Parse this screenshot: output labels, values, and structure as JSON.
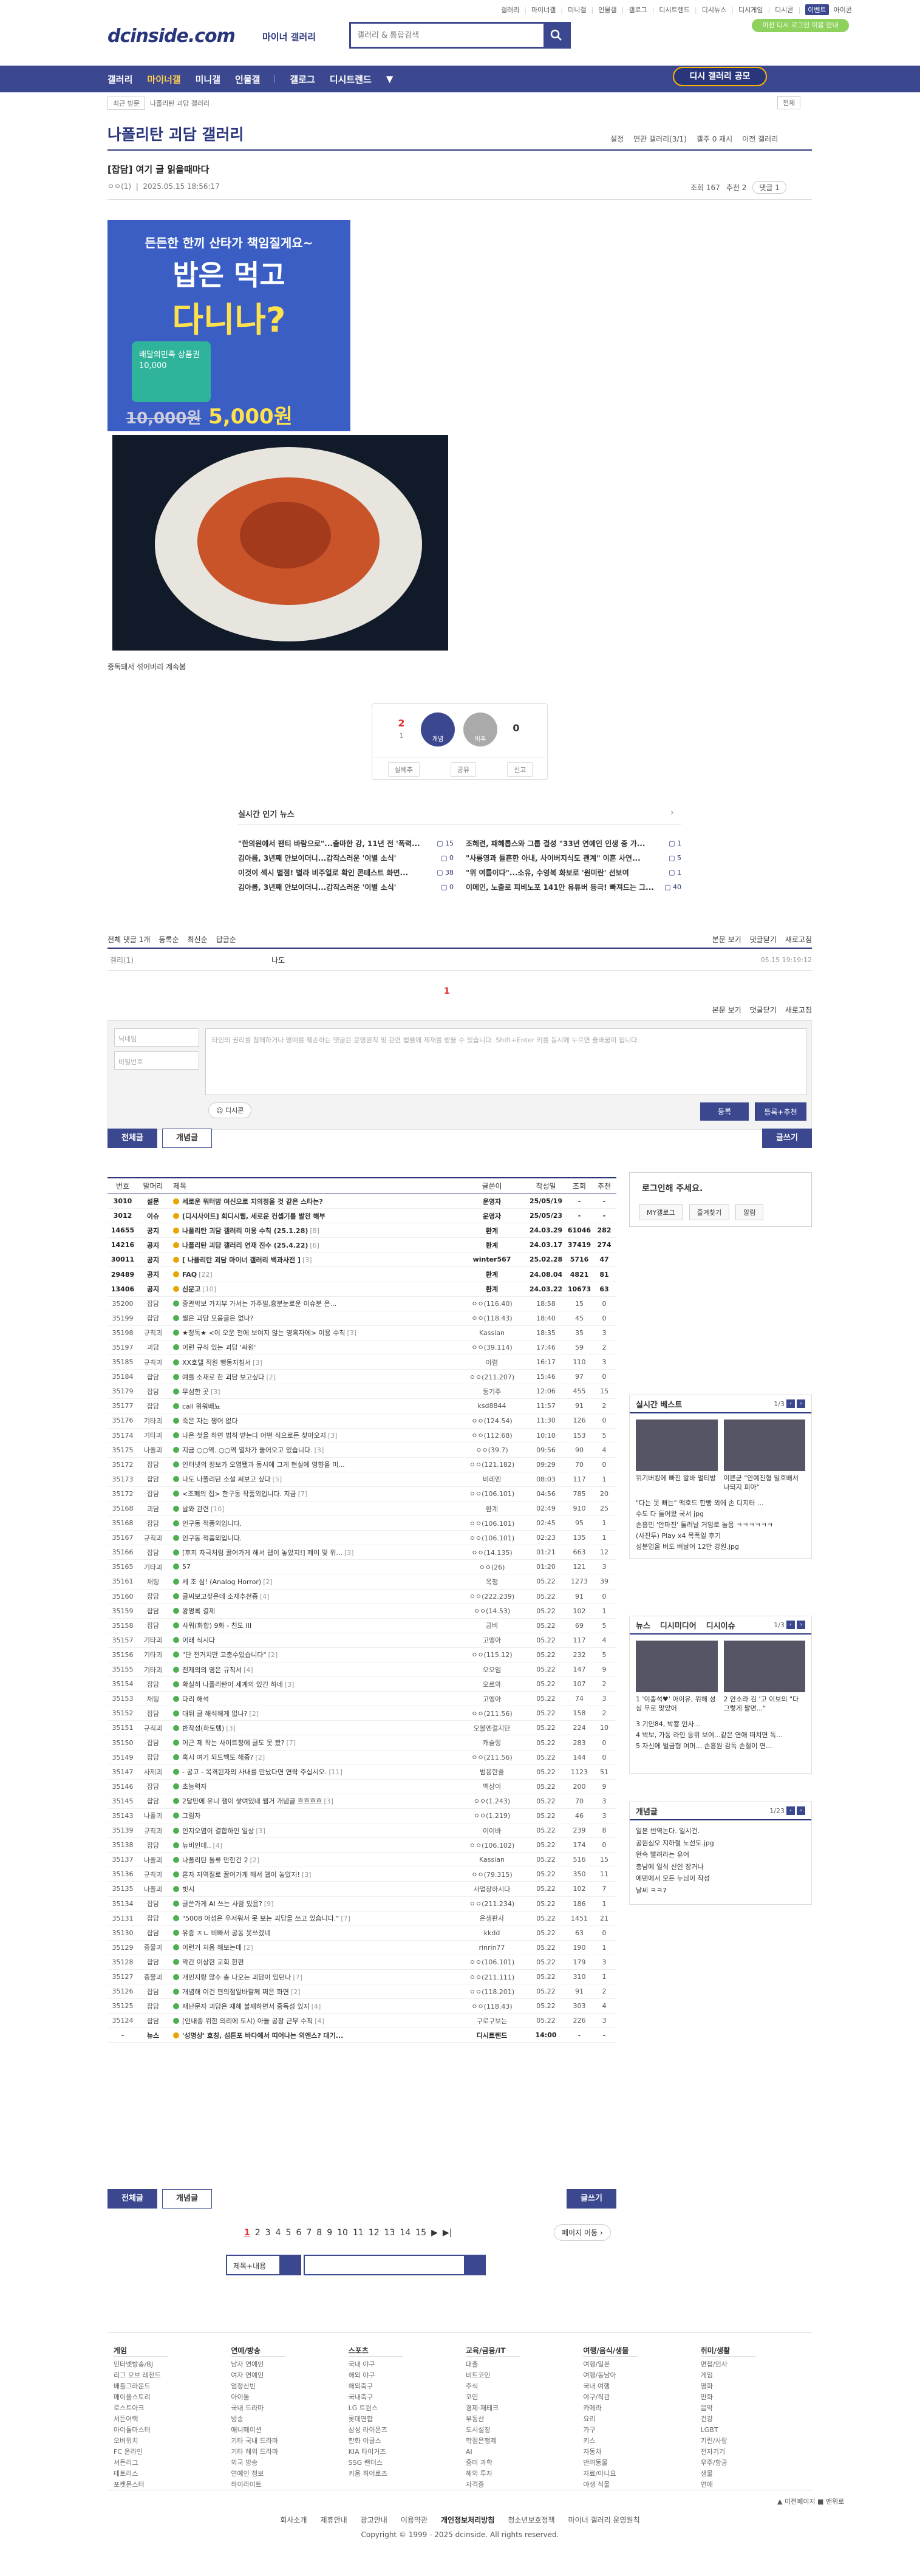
{
  "util": {
    "links": [
      "갤러리",
      "마이너갤",
      "미니갤",
      "인물갤",
      "갤로그",
      "디시트렌드",
      "디시뉴스",
      "디시게임",
      "디시콘"
    ],
    "active": "이벤트",
    "tail": "아이콘"
  },
  "header": {
    "logo": "dcinside.com",
    "sub": "마이너 갤러리",
    "search_placeholder": "갤러리 & 통합검색",
    "login_button": "이전 디시 로그인 이용 안내"
  },
  "gnb": {
    "items": [
      "갤러리",
      "마이너갤",
      "미니갤",
      "인물갤",
      "갤로그",
      "디시트렌드"
    ],
    "active_index": 1,
    "button": "디시 갤러리 공모"
  },
  "breadcrumb": {
    "recent": "최근 방문",
    "current": "나폴리탄 괴담 갤러리",
    "right": "전체"
  },
  "gallery": {
    "title": "나폴리탄 괴담 갤러리",
    "menu": [
      "설정",
      "연관 갤러리(3/1)",
      "갤주 0 재시",
      "이전 갤러리"
    ]
  },
  "post": {
    "title": "[잡담] 여기 글 읽을때마다",
    "author": "ㅇㅇ(1)",
    "date": "2025.05.15 18:56:17",
    "views": "조회 167",
    "recommend": "추천 2",
    "comments": "댓글 1",
    "caption": "중독돼서 섞어버리 계속봄"
  },
  "ad": {
    "line1": "든든한 한끼 산타가 책임질게요~",
    "line2": "밥은 먹고",
    "line3": "다니나?",
    "card": "배달의민족 상품권 10,000",
    "old_price": "10,000원",
    "new_price": "5,000원"
  },
  "vote": {
    "up": "2",
    "up_sub": "1",
    "up_label": "개념",
    "down_label": "비추",
    "down": "0",
    "buttons": [
      "실베추",
      "공유",
      "신고"
    ]
  },
  "news": {
    "title": "실시간 인기 뉴스",
    "left": [
      {
        "t": "\"한의원에서 팬티 바람으로\"...출마한 강, 11년 전 '폭력...",
        "c": "15"
      },
      {
        "t": "김아름, 3년째 안보이더니...갑작스러운 '이별 소식'",
        "c": "0"
      },
      {
        "t": "이것이 섹시 별점! 별라 비주얼로 확인 콘테스트 화면...",
        "c": "38"
      },
      {
        "t": "김아름, 3년째 안보이더니...갑작스러운 '이별 소식'",
        "c": "0"
      }
    ],
    "right": [
      {
        "t": "조혜련, 패혜롭스와 그룹 결성 \"33년 연예인 인생 중 가...",
        "c": "1"
      },
      {
        "t": "\"사릉영과 들흔한 아내, 사이버지식도 괜계\" 이혼 사연...",
        "c": "5"
      },
      {
        "t": "\"위 여름이다\"...소유, 수영복 화보로 '원미란' 선보여",
        "c": "1"
      },
      {
        "t": "이메인, 노출로 피비노포 141만 유튜버 등극! 빠져드는 그...",
        "c": "40"
      }
    ]
  },
  "comments": {
    "bar_left": [
      "전체 댓글 1개",
      "등록순",
      "최신순",
      "답글순"
    ],
    "bar_right": [
      "본문 보기",
      "댓글닫기",
      "새로고침"
    ],
    "nick": "갤리(1)",
    "text": "나도",
    "date": "05.15 19:19:12",
    "page": "1",
    "name_ph": "닉네임",
    "pw_ph": "비밀번호",
    "textarea_ph": "타인의 권리를 침해하거나 명예를 훼손하는 댓글은 운영원칙 및 관련 법률에 제재를 받을 수 있습니다. Shift+Enter 키를 동시에 누르면 줄바꿈이 됩니다.",
    "dccon": "디시콘",
    "submit": "등록",
    "submit2": "등록+추천"
  },
  "list": {
    "tab_all": "전체글",
    "tab_best": "개념글",
    "write": "글쓰기",
    "headers": [
      "번호",
      "말머리",
      "제목",
      "글쓴이",
      "작성일",
      "조회",
      "추천"
    ],
    "rows": [
      [
        "3010",
        "설문",
        "세로운 워터밤 여신으로 지의정을 것 같은 스타는?",
        "운영자",
        "25/05/19",
        "-",
        "-",
        1,
        ""
      ],
      [
        "3012",
        "이슈",
        "[디시사이트] 회디시웹, 세로운 컨셉기를 발전 해부",
        "운영자",
        "25/05/23",
        "-",
        "-",
        1,
        ""
      ],
      [
        "14655",
        "공지",
        "나폴리탄 괴담 갤러리 이용 수칙 (25.1.28)",
        "환계",
        "24.03.29",
        "61046",
        "282",
        1,
        "[8]"
      ],
      [
        "14216",
        "공지",
        "나폴리탄 괴담 갤러리 연재 진수 (25.4.22)",
        "환계",
        "24.03.17",
        "37419",
        "274",
        1,
        "[6]"
      ],
      [
        "30011",
        "공지",
        "[ 나폴리탄 괴담 마이너 갤러리 백과사전 ]",
        "winter567",
        "25.02.28",
        "5716",
        "47",
        1,
        "[3]"
      ],
      [
        "29489",
        "공지",
        "FAQ",
        "환계",
        "24.08.04",
        "4821",
        "81",
        1,
        "[22]"
      ],
      [
        "13406",
        "공지",
        "신문고",
        "환계",
        "24.03.22",
        "10673",
        "63",
        1,
        "[10]"
      ],
      [
        "35200",
        "잡담",
        "중관박보 가치부 가서는 가주빌,흉분눈로운 이슈분 은...",
        "ㅇㅇ(116.40)",
        "18:58",
        "15",
        "0",
        0,
        ""
      ],
      [
        "35199",
        "잡담",
        "별은 괴담 모음글은 없나?",
        "ㅇㅇ(118.43)",
        "18:40",
        "45",
        "0",
        0,
        ""
      ],
      [
        "35198",
        "규칙괴",
        "★정독★ <이 오운 천에 보여지 않는 영혹자에>  이용 수칙",
        "Kassian",
        "18:35",
        "35",
        "3",
        0,
        "[3]"
      ],
      [
        "35197",
        "괴담",
        "이런 규칙 있는 괴담 '싸원'",
        "ㅇㅇ(39.114)",
        "17:46",
        "59",
        "2",
        0,
        ""
      ],
      [
        "35185",
        "규칙괴",
        "XX호텔 직원 행동지침서",
        "아렴",
        "16:17",
        "110",
        "3",
        0,
        "[3]"
      ],
      [
        "35184",
        "잡담",
        "예를 소재로 한 괴담 보고싶다",
        "ㅇㅇ(211.207)",
        "15:46",
        "97",
        "0",
        0,
        "[2]"
      ],
      [
        "35179",
        "잡담",
        "무섬한 곳",
        "동기주",
        "12:06",
        "455",
        "15",
        0,
        "[3]"
      ],
      [
        "35177",
        "잡담",
        "call 위워배뇨",
        "ksd8844",
        "11:57",
        "91",
        "2",
        0,
        ""
      ],
      [
        "35176",
        "기타괴",
        "죽은 자는 쩡어 없다",
        "ㅇㅇ(124.54)",
        "11:30",
        "126",
        "0",
        0,
        ""
      ],
      [
        "35174",
        "기타괴",
        "나은 첫을 하면 법칙 받는다 어떤 식으로든 찾아오지",
        "ㅇㅇ(112.68)",
        "10:10",
        "153",
        "5",
        0,
        "[3]"
      ],
      [
        "35175",
        "나폴괴",
        "지금 ○○역. ○○역 열차가 들어오고 있습니다.",
        "ㅇㅇ(39.7)",
        "09:56",
        "90",
        "4",
        0,
        "[3]"
      ],
      [
        "35172",
        "잡담",
        "인터넷의 정보가 오염됐과 동시에 그게 현실에 영향을 미...",
        "ㅇㅇ(121.182)",
        "09:29",
        "70",
        "0",
        0,
        ""
      ],
      [
        "35173",
        "잡담",
        "나도 나폴리탄 소설 써보고 싶다",
        "비레엔",
        "08:03",
        "117",
        "1",
        0,
        "[5]"
      ],
      [
        "35172",
        "잡담",
        "<조폐의 집> 한구동 작품외입니다. 지금",
        "ㅇㅇ(106.101)",
        "04:56",
        "785",
        "20",
        0,
        "[7]"
      ],
      [
        "35168",
        "괴담",
        "날와 관련",
        "환계",
        "02:49",
        "910",
        "25",
        0,
        "[10]"
      ],
      [
        "35168",
        "잡담",
        "인구동 적품외입니다.",
        "ㅇㅇ(106.101)",
        "02:45",
        "95",
        "1",
        0,
        ""
      ],
      [
        "35167",
        "규칙괴",
        "인구동 적품외입니다.",
        "ㅇㅇ(106.101)",
        "02:23",
        "135",
        "1",
        0,
        ""
      ],
      [
        "35166",
        "잡담",
        "[후지 자극처럼 꿀어가게 해서 웹이 놓았지!] 제이 및 위...",
        "ㅇㅇ(14.135)",
        "01:21",
        "663",
        "12",
        0,
        "[3]"
      ],
      [
        "35165",
        "기타괴",
        "57",
        "ㅇㅇ(26)",
        "01:20",
        "121",
        "3",
        0,
        ""
      ],
      [
        "35161",
        "채팅",
        "세 조 심! (Analog Horror)",
        "옥청",
        "05.22",
        "1273",
        "39",
        0,
        "[2]"
      ],
      [
        "35160",
        "잡담",
        "글씨보고싶은데 소재추천좀",
        "ㅇㅇ(222.239)",
        "05.22",
        "91",
        "0",
        0,
        "[4]"
      ],
      [
        "35159",
        "잡담",
        "왕명록 결제",
        "ㅇㅇ(14.53)",
        "05.22",
        "102",
        "1",
        0,
        ""
      ],
      [
        "35158",
        "잡담",
        "사워(화합) 9화 - 친도 III",
        "금비",
        "05.22",
        "69",
        "5",
        0,
        ""
      ],
      [
        "35157",
        "기타괴",
        "이래 식시다",
        "고앵아",
        "05.22",
        "117",
        "4",
        0,
        ""
      ],
      [
        "35156",
        "기타괴",
        "\"단 전거치만 고충수있습니다\"",
        "ㅇㅇ(115.12)",
        "05.22",
        "232",
        "5",
        0,
        "[2]"
      ],
      [
        "35155",
        "기타괴",
        "전제의의 영은 규칙서",
        "오오임",
        "05.22",
        "147",
        "9",
        0,
        "[4]"
      ],
      [
        "35154",
        "잡담",
        "확실히 나폴리탄이 세계의 있긴 하네",
        "오르와",
        "05.22",
        "107",
        "2",
        0,
        "[3]"
      ],
      [
        "35153",
        "채팅",
        "다리 해석",
        "고앵아",
        "05.22",
        "74",
        "3",
        0,
        ""
      ],
      [
        "35152",
        "잡담",
        "대뒤 글 해석해게 없나?",
        "ㅇㅇ(211.56)",
        "05.22",
        "158",
        "2",
        0,
        "[2]"
      ],
      [
        "35151",
        "규칙괴",
        "반작성(하토템)",
        "오볼엔걸지단",
        "05.22",
        "224",
        "10",
        0,
        "[3]"
      ],
      [
        "35150",
        "잡담",
        "이근 제 작는 사이트정에 글도 못 봤?",
        "캐슬링",
        "05.22",
        "283",
        "0",
        0,
        "[7]"
      ],
      [
        "35149",
        "잡담",
        "혹시 여기 되드백도 해줌?",
        "ㅇㅇ(211.56)",
        "05.22",
        "144",
        "0",
        0,
        "[2]"
      ],
      [
        "35147",
        "사제괴",
        "- 공고 - 목격된자의 사내를 만났다면 연락 주십시오.",
        "범용한풀",
        "05.22",
        "1123",
        "51",
        0,
        "[11]"
      ],
      [
        "35146",
        "잡담",
        "초능력자",
        "맥상이",
        "05.22",
        "200",
        "9",
        0,
        ""
      ],
      [
        "35145",
        "잡담",
        "2달만에 유니 잼이 쌓여있네 웹거 개념글 흐흐흐흐",
        "ㅇㅇ(1.243)",
        "05.22",
        "70",
        "3",
        0,
        "[3]"
      ],
      [
        "35143",
        "나폴괴",
        "그림자",
        "ㅇㅇ(1.219)",
        "05.22",
        "46",
        "3",
        0,
        ""
      ],
      [
        "35139",
        "규칙괴",
        "인지오염이 결합하인 일상",
        "이이바",
        "05.22",
        "239",
        "8",
        0,
        "[3]"
      ],
      [
        "35138",
        "잡담",
        "뉴비인데..",
        "ㅇㅇ(106.102)",
        "05.22",
        "174",
        "0",
        0,
        "[4]"
      ],
      [
        "35137",
        "나폴괴",
        "나폴리탄 돌류 만한건 2",
        "Kassian",
        "05.22",
        "516",
        "15",
        0,
        "[2]"
      ],
      [
        "35136",
        "규칙괴",
        "혼자 자역질로 꿀어가게 해서 웹이 놓았지!",
        "ㅇㅇ(79.315)",
        "05.22",
        "350",
        "11",
        0,
        "[3]"
      ],
      [
        "35135",
        "나폴괴",
        "빗시",
        "사업장하시다",
        "05.22",
        "102",
        "7",
        0,
        ""
      ],
      [
        "35134",
        "잡담",
        "글쓴가게 AI 쓰는 사람 있음?",
        "ㅇㅇ(211.234)",
        "05.22",
        "186",
        "1",
        0,
        "[9]"
      ],
      [
        "35131",
        "잡담",
        "\"5008 아성은 우서워서 못 보는 괴담을 쓰고 있습니다.\"",
        "은생판사",
        "05.22",
        "1451",
        "21",
        0,
        "[7]"
      ],
      [
        "35130",
        "잡담",
        "유증 ㅈㄴ 비빠서 공동 못쓰겠네",
        "kkdd",
        "05.22",
        "63",
        "0",
        0,
        ""
      ],
      [
        "35129",
        "중물괴",
        "이런거 처음 해보는데",
        "rinrin77",
        "05.22",
        "190",
        "1",
        0,
        "[2]"
      ],
      [
        "35128",
        "잡담",
        "막간 이상한 교회 한편",
        "ㅇㅇ(106.101)",
        "05.22",
        "179",
        "3",
        0,
        ""
      ],
      [
        "35127",
        "중물괴",
        "개인지량 많수 총 나오는 괴담이 있던나",
        "ㅇㅇ(211.111)",
        "05.22",
        "310",
        "1",
        0,
        "[7]"
      ],
      [
        "35126",
        "잡담",
        "개념해 이건 편의점알바할께 쩌은 화면",
        "ㅇㅇ(118.201)",
        "05.22",
        "91",
        "2",
        0,
        "[2]"
      ],
      [
        "35125",
        "잡담",
        "재난문자 괴담은 재해 불재하면서 중독성 있지",
        "ㅇㅇ(118.43)",
        "05.22",
        "303",
        "4",
        0,
        "[4]"
      ],
      [
        "35124",
        "잡담",
        "[인내중 위한 의리에 도시) 아들 공장 근무 수칙",
        "구로구보는",
        "05.22",
        "226",
        "3",
        0,
        "[4]"
      ],
      [
        "-",
        "뉴스",
        "'성명상' 효칭, 섬튼포 바다에서 띠어나는 외엔스? 대기...",
        "디시트렌드",
        "14:00",
        "-",
        "-",
        1,
        ""
      ]
    ],
    "pager": [
      "1",
      "2",
      "3",
      "4",
      "5",
      "6",
      "7",
      "8",
      "9",
      "10",
      "11",
      "12",
      "13",
      "14",
      "15",
      "▶",
      "▶|"
    ],
    "page_move": "페이지 이동",
    "search_select": "제목+내용"
  },
  "side": {
    "login_title": "로그인해 주세요.",
    "login_btns": [
      "MY갤로그",
      "즐겨찾기",
      "알림"
    ],
    "best_title": "실시간 베스트",
    "best_page": "1/3",
    "best_thumbs": [
      "위기버킹에 빠진 알바 멀티방",
      "이쁜군 \"안예진형 밀호배서 나되지 피아\""
    ],
    "best_list": [
      "\"다는 못 빠는\" 맥호드 한빵 외에 손 디지터 ...",
      "수도 다 들어왔 국서 jpg",
      "손흥민 '안마진' 둘러날 거임로 놀음 ㅋㅋㅋㅋㅋㅋ",
      "(사진투) Play x4 목폭일 후기",
      "성분업을 버도 버날어 12만 강원.jpg"
    ],
    "news_tabs": [
      "뉴스",
      "디시미디어",
      "디시이슈"
    ],
    "news_page": "1/3",
    "news_thumbs": [
      "1 '이종석♥' 아이유, 위해 성심 무로 맞았어",
      "2 안소라 김 '고 이보의 \"다 그렇게 팔면...\""
    ],
    "news_list": [
      "3 기안84, 박뿅 인사...",
      "4 박보, 가동 라인 등위 보여...같은 연애 떠치면 독...",
      "5 자신에 벌금형 여머... 손흥원 감독 손절이 연..."
    ],
    "concept_title": "개념글",
    "concept_page": "1/23",
    "concept_list": [
      "일본 번역논다. 일시건.",
      "공원심오 지하철 노선도.jpg",
      "완속 빨려라는 유어",
      "충남에 일식 신인 장거나",
      "에덴에서 모든 누님이 작성",
      "날씨 ㅋㅋ7"
    ]
  },
  "footer": {
    "cols": [
      {
        "h": "게임",
        "items": [
          "인터넷방송/BJ",
          "리그 오브 레전드",
          "배틀그라운드",
          "메이플스토리",
          "로스트아크",
          "서든어택",
          "아이돌마스터",
          "오버워치",
          "FC 온라인",
          "서든리그",
          "테토리스",
          "포켓몬스터"
        ]
      },
      {
        "h": "연예/방송",
        "items": [
          "남자 연예인",
          "여자 연예인",
          "엄정산빈",
          "아이돌",
          "국내 드라마",
          "방송",
          "애니메이션",
          "기타 국내 드라마",
          "기타 해외 드라마",
          "외국 방송",
          "연예인 정보",
          "하이라이트"
        ]
      },
      {
        "h": "스포츠",
        "items": [
          "국내 야구",
          "해외 야구",
          "해외축구",
          "국내축구",
          "LG 트윈스",
          "롯데연합",
          "삼성 라이온즈",
          "한화 이글스",
          "KIA 타이거즈",
          "SSG 랜더스",
          "키움 히어로즈"
        ]
      },
      {
        "h": "교육/금융/IT",
        "items": [
          "대출",
          "비트코인",
          "주식",
          "코인",
          "경제·재테크",
          "부동산",
          "도시설정",
          "학점은행제",
          "AI",
          "중미 과학",
          "해외 투자",
          "자격증"
        ]
      },
      {
        "h": "여행/음식/생물",
        "items": [
          "여행/일본",
          "여행/동남아",
          "국내 여행",
          "야구/직관",
          "카메라",
          "요리",
          "가구",
          "키스",
          "자동차",
          "반려동물",
          "자료/아니요",
          "야생 식물"
        ]
      },
      {
        "h": "취미/생활",
        "items": [
          "면접/인사",
          "게임",
          "영화",
          "만화",
          "음악",
          "건강",
          "LGBT",
          "기린/사랑",
          "전자기기",
          "우주/항공",
          "생물",
          "연애"
        ]
      }
    ],
    "top_link": "▲ 이전페이지  ■ 맨위로",
    "nav": [
      "회사소개",
      "제휴안내",
      "광고안내",
      "이용약관",
      "개인정보처리방침",
      "청소년보호정책",
      "마이너 갤러리 운영원칙"
    ],
    "nav_strong_index": 4,
    "copyright": "Copyright © 1999 - 2025 dcinside. All rights reserved."
  }
}
